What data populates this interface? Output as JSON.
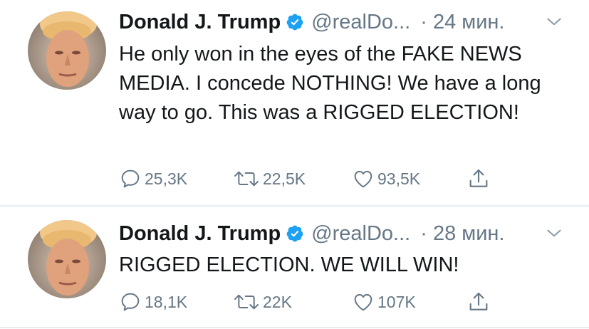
{
  "colors": {
    "primary_text": "#14171a",
    "secondary_text": "#657786",
    "verified_blue": "#1da1f2",
    "divider": "#e6ecf0"
  },
  "tweets": [
    {
      "author": {
        "name": "Donald J. Trump",
        "handle": "@realDo...",
        "verified_icon": "verified-badge-icon"
      },
      "time": "· 24 мин.",
      "text": "He only won in the eyes of the FAKE NEWS MEDIA. I concede NOTHING! We have a long way to go. This was a RIGGED ELECTION!",
      "actions": {
        "replies": "25,3K",
        "retweets": "22,5K",
        "likes": "93,5K"
      }
    },
    {
      "author": {
        "name": "Donald J. Trump",
        "handle": "@realDo...",
        "verified_icon": "verified-badge-icon"
      },
      "time": "· 28 мин.",
      "text": "RIGGED ELECTION. WE WILL WIN!",
      "actions": {
        "replies": "18,1K",
        "retweets": "22K",
        "likes": "107K"
      }
    }
  ]
}
